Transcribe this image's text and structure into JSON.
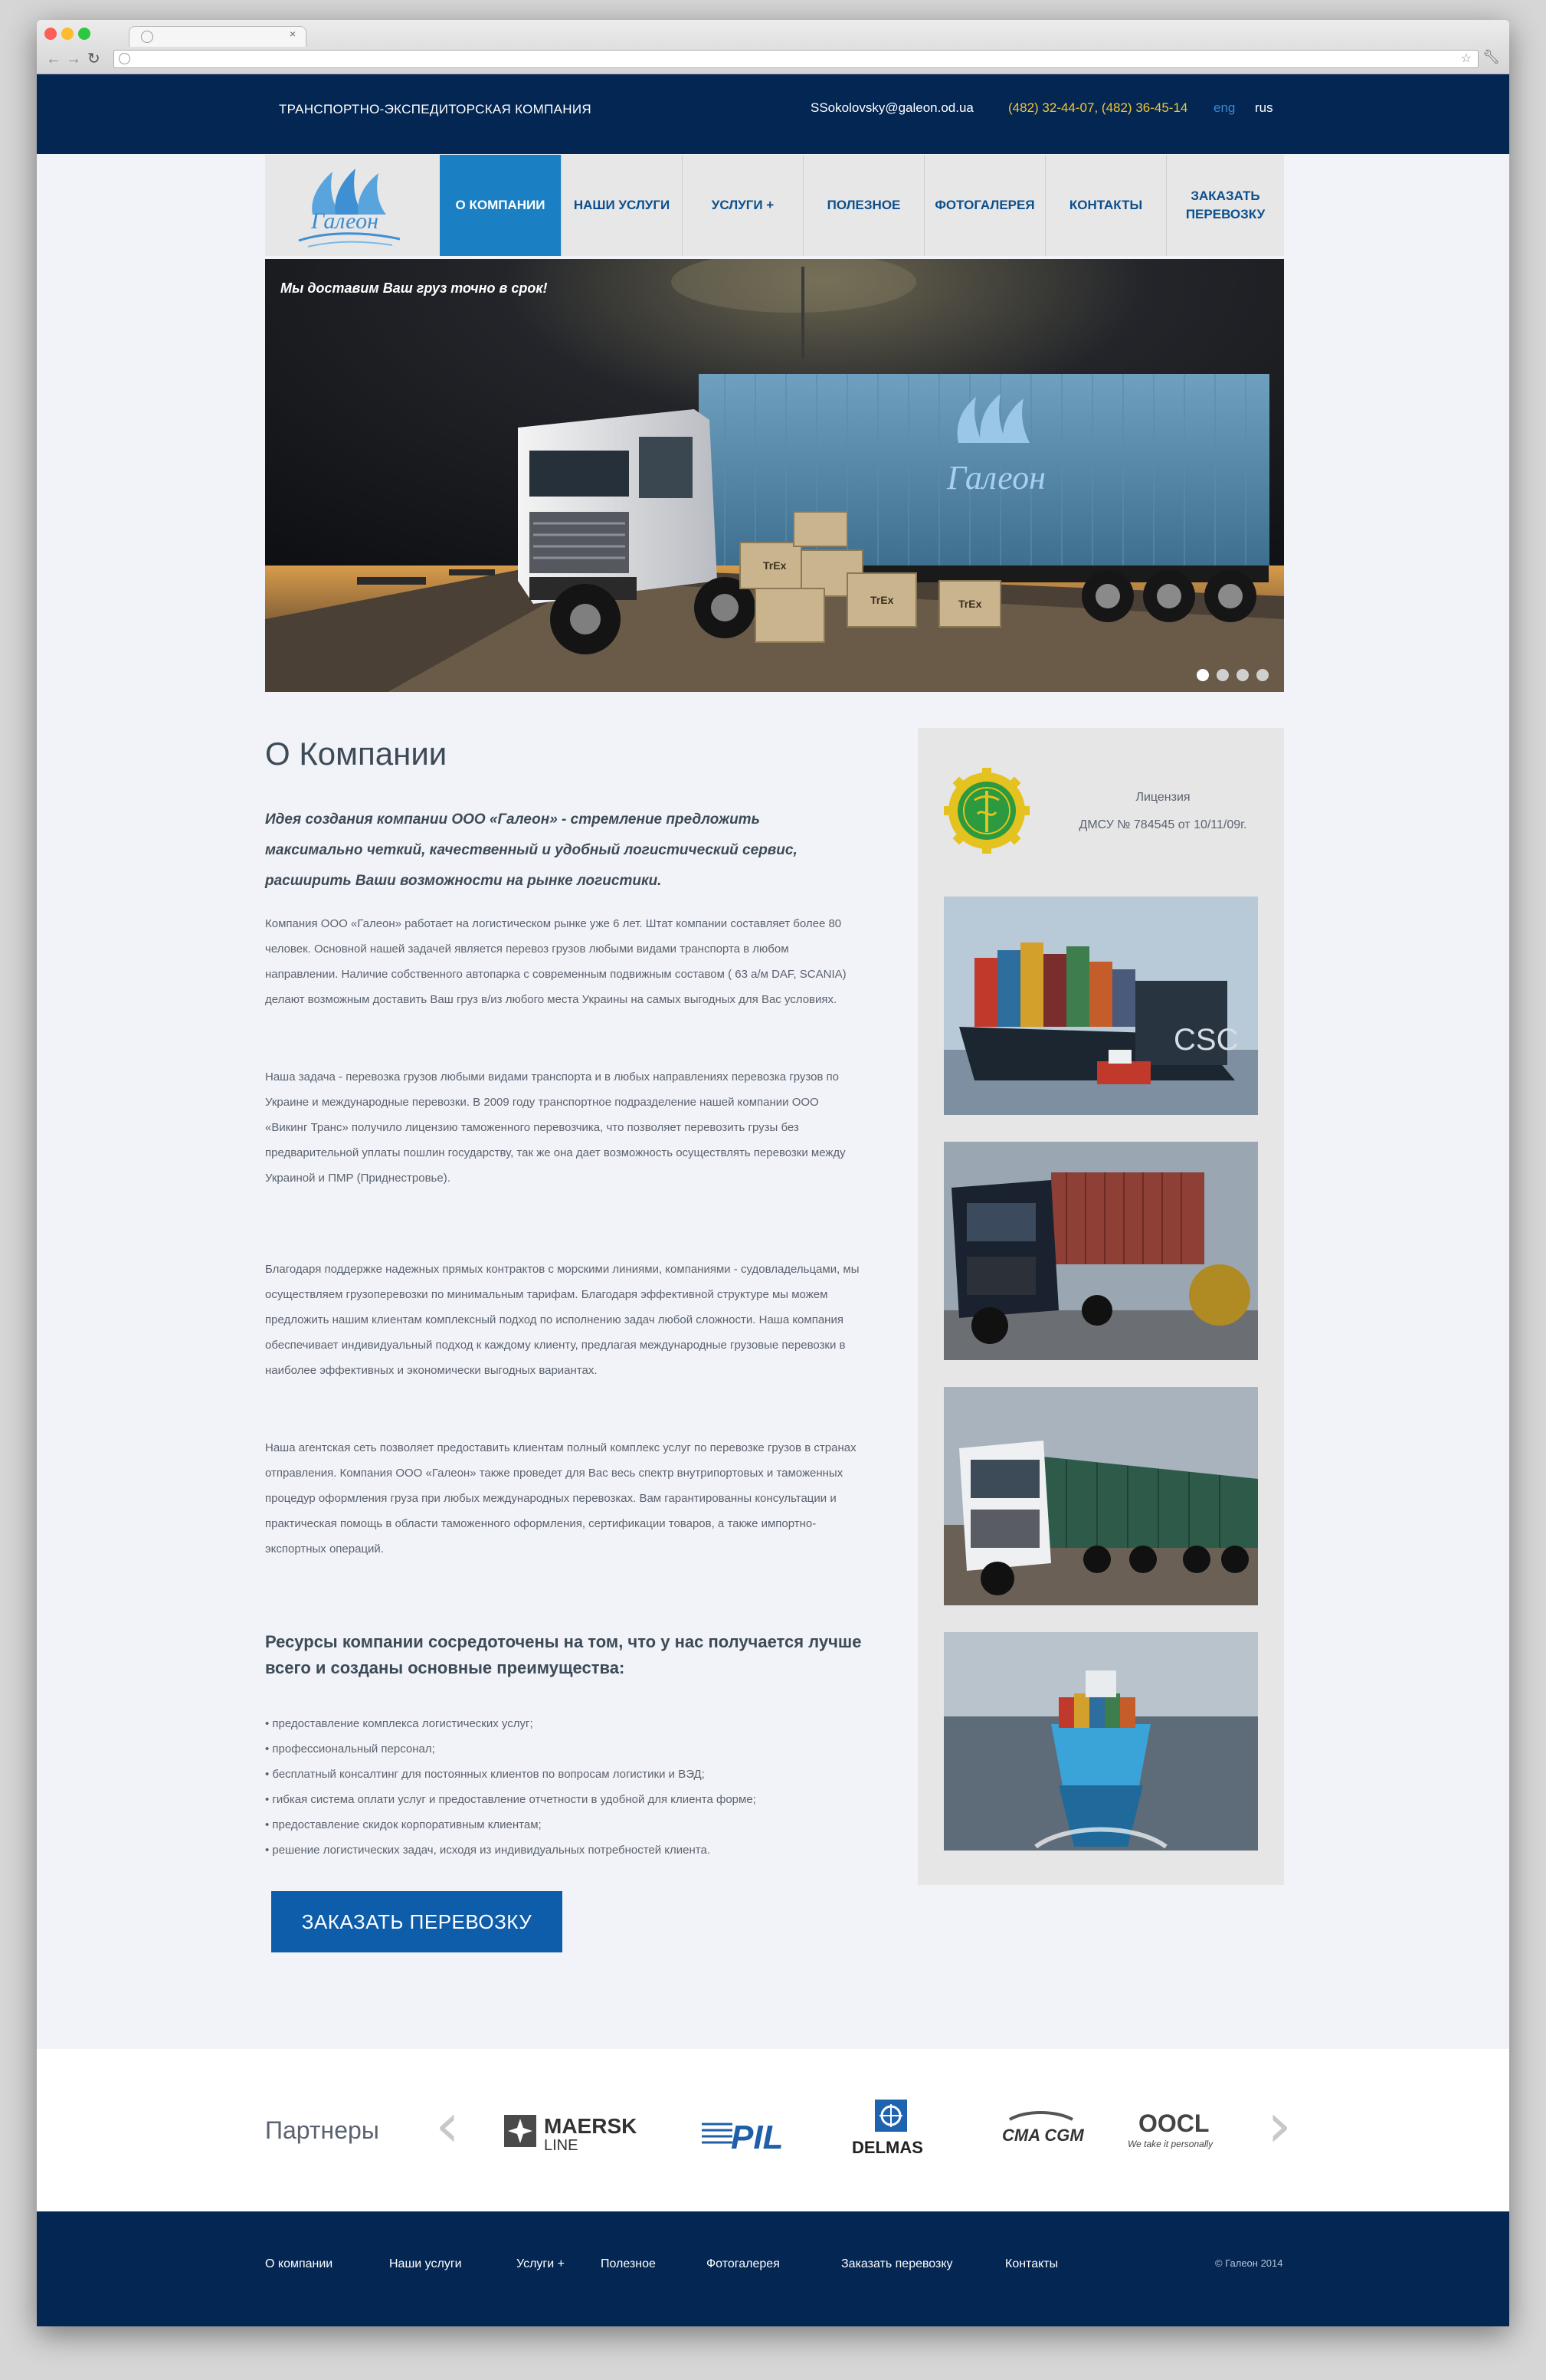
{
  "browser": {
    "back_icon": "back-arrow-icon",
    "forward_icon": "forward-arrow-icon",
    "reload_icon": "reload-icon"
  },
  "topbar": {
    "tagline": "ТРАНСПОРТНО-ЭКСПЕДИТОРСКАЯ КОМПАНИЯ",
    "email": "SSokolovsky@galeon.od.ua",
    "phones": "(482) 32-44-07, (482) 36-45-14",
    "lang_eng": "eng",
    "lang_rus": "rus"
  },
  "logo": {
    "text": "Галеон"
  },
  "nav": {
    "items": [
      {
        "label": "О КОМПАНИИ",
        "active": true
      },
      {
        "label": "НАШИ УСЛУГИ"
      },
      {
        "label": "УСЛУГИ +"
      },
      {
        "label": "ПОЛЕЗНОЕ"
      },
      {
        "label": "ФОТОГАЛЕРЕЯ"
      },
      {
        "label": "КОНТАКТЫ"
      },
      {
        "label": "ЗАКАЗАТЬ ПЕРЕВОЗКУ"
      }
    ]
  },
  "hero": {
    "caption": "Мы доставим Ваш груз точно в срок!",
    "container_logo": "Галеон",
    "box_label": "TrEx",
    "slides_count": 4,
    "active_slide": 1
  },
  "main": {
    "title": "О Компании",
    "lead": "Идея создания компании ООО «Галеон» - стремление предложить максимально четкий, качественный и удобный логистический сервис, расширить Ваши возможности на рынке логистики.",
    "paragraphs": [
      "Компания ООО «Галеон» работает на логистическом рынке уже 6 лет. Штат компании составляет более 80 человек. Основной нашей задачей является перевоз грузов любыми видами транспорта в любом направлении. Наличие собственного автопарка с современным подвижным составом ( 63 а/м DAF, SCANIA) делают возможным доставить  Ваш груз в/из любого места Украины на самых выгодных для Вас условиях.",
      "Наша задача - перевозка грузов любыми видами транспорта и в любых направлениях перевозка грузов по Украине и международные перевозки.  В 2009 году транспортное подразделение нашей компании ООО «Викинг Транс» получило лицензию таможенного перевозчика, что позволяет перевозить грузы без предварительной уплаты пошлин государству, так же она дает возможность осуществлять перевозки между Украиной и ПМР (Приднестровье).",
      "Благодаря поддержке надежных прямых контрактов с морскими линиями, компаниями - судовладельцами, мы осуществляем грузоперевозки по минимальным тарифам. Благодаря эффективной структуре мы можем предложить нашим клиентам комплексный подход по исполнению задач любой сложности. Наша компания обеспечивает индивидуальный подход к каждому клиенту, предлагая международные грузовые перевозки в наиболее эффективных и экономически выгодных вариантах.",
      "Наша агентская сеть позволяет предоставить клиентам полный комплекс услуг по перевозке грузов в странах отправления. Компания ООО «Галеон» также проведет для Вас весь спектр внутрипортовых и таможенных процедур оформления груза при любых международных перевозках. Вам гарантированны консультации и практическая помощь в области таможенного оформления, сертификации товаров, а также импортно-экспортных операций."
    ],
    "subheading": "Ресурсы компании сосредоточены на том, что у нас получается лучше всего и созданы основные преимущества:",
    "bullets": [
      "• предоставление комплекса логистических услуг;",
      "• профессиональный персонал;",
      "• бесплатный консалтинг для постоянных клиентов по вопросам логистики и ВЭД;",
      "• гибкая система оплати услуг и предоставление отчетности в удобной для клиента форме;",
      "• предоставление скидок корпоративным клиентам;",
      "• решение логистических задач, исходя из индивидуальных потребностей клиента."
    ],
    "order_button": "ЗАКАЗАТЬ ПЕРЕВОЗКУ"
  },
  "sidebar": {
    "license_title": "Лицензия",
    "license_number": "ДМСУ № 784545 от 10/11/09г.",
    "ship_hull_text": "CSC"
  },
  "partners": {
    "title": "Партнеры",
    "maersk_line1": "MAERSK",
    "maersk_line2": "LINE",
    "pil": "PIL",
    "delmas": "DELMAS",
    "cma": "CMA CGM",
    "oocl": "OOCL",
    "oocl_tagline": "We take it personally"
  },
  "footer": {
    "links": [
      "О компании",
      "Наши услуги",
      "Услуги +",
      "Полезное",
      "Фотогалерея",
      "Заказать перевозку",
      "Контакты"
    ],
    "copyright": "© Галеон 2014"
  },
  "colors": {
    "navy": "#032653",
    "accent_blue": "#1a7fc3",
    "button_blue": "#0d5dab",
    "phone_yellow": "#f3c433"
  }
}
